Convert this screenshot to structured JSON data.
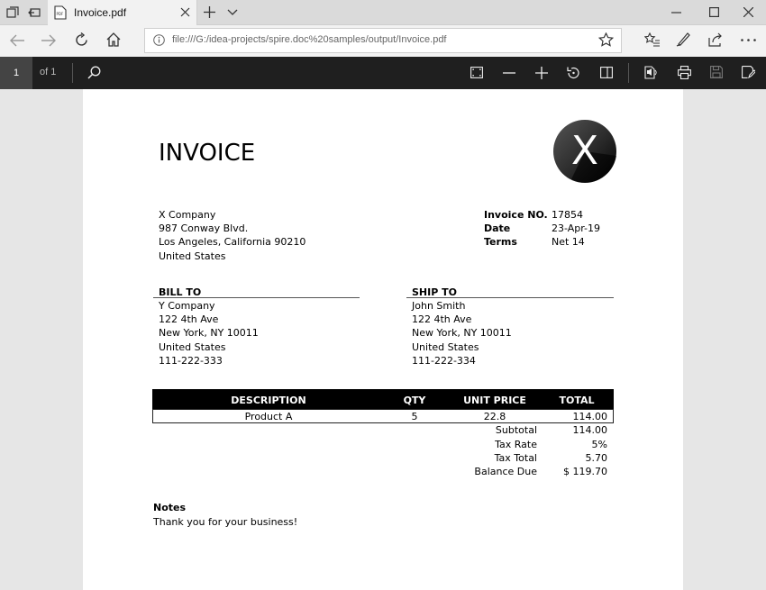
{
  "browser": {
    "tab_title": "Invoice.pdf",
    "url": "file:///G:/idea-projects/spire.doc%20samples/output/Invoice.pdf"
  },
  "pdf_toolbar": {
    "page_number": "1",
    "page_count": "of 1"
  },
  "invoice": {
    "title": "INVOICE",
    "logo_letter": "X",
    "from": [
      "X Company",
      "987 Conway Blvd.",
      "Los Angeles, California 90210",
      "United States"
    ],
    "meta": [
      {
        "label": "Invoice NO.",
        "value": "17854"
      },
      {
        "label": "Date",
        "value": "23-Apr-19"
      },
      {
        "label": "Terms",
        "value": "Net 14"
      }
    ],
    "bill_to": {
      "heading": "BILL TO",
      "lines": [
        "Y Company",
        "122 4th Ave",
        "New York, NY 10011",
        "United States",
        "111-222-333"
      ]
    },
    "ship_to": {
      "heading": "SHIP TO",
      "lines": [
        "John Smith",
        "122 4th Ave",
        "New York, NY 10011",
        "United States",
        "111-222-334"
      ]
    },
    "table": {
      "headers": [
        "DESCRIPTION",
        "QTY",
        "UNIT PRICE",
        "TOTAL"
      ],
      "rows": [
        {
          "description": "Product A",
          "qty": "5",
          "unit_price": "22.8",
          "total": "114.00"
        }
      ]
    },
    "totals": [
      {
        "label": "Subtotal",
        "value": "114.00"
      },
      {
        "label": "Tax Rate",
        "value": "5%"
      },
      {
        "label": "Tax Total",
        "value": "5.70"
      },
      {
        "label": "Balance Due",
        "value": "$ 119.70"
      }
    ],
    "notes": {
      "heading": "Notes",
      "text": "Thank you for your business!"
    }
  }
}
